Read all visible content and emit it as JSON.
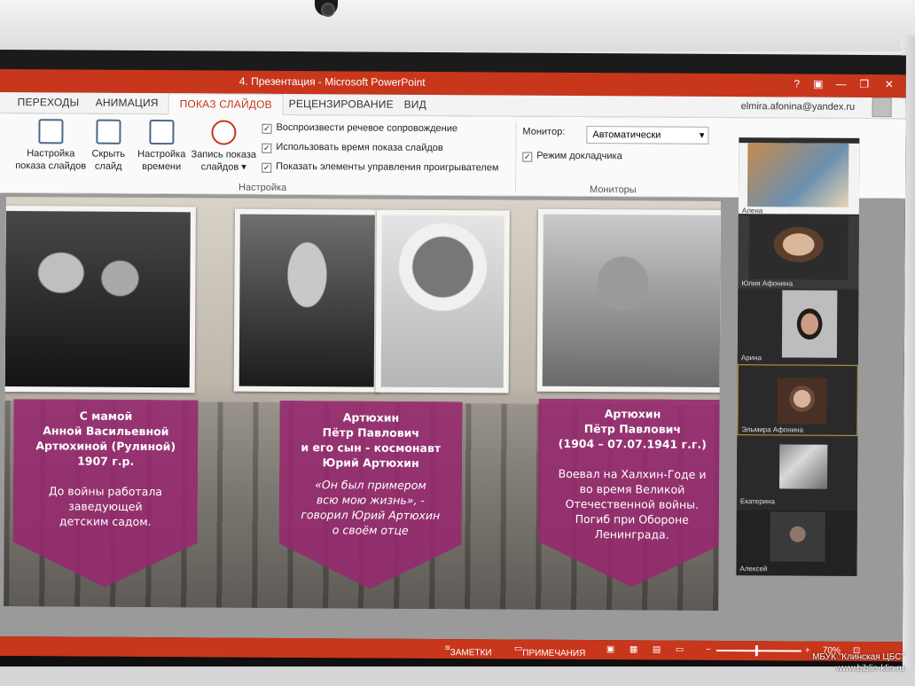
{
  "window": {
    "title": "4. Презентация -  Microsoft PowerPoint",
    "help": "?",
    "account": "elmira.afonina@yandex.ru"
  },
  "tabs": [
    "ПЕРЕХОДЫ",
    "АНИМАЦИЯ",
    "ПОКАЗ СЛАЙДОВ",
    "РЕЦЕНЗИРОВАНИЕ",
    "ВИД"
  ],
  "active_tab": "ПОКАЗ СЛАЙДОВ",
  "ribbon": {
    "buttons": [
      {
        "label1": "Настройка",
        "label2": "показа слайдов"
      },
      {
        "label1": "Скрыть",
        "label2": "слайд"
      },
      {
        "label1": "Настройка",
        "label2": "времени"
      },
      {
        "label1": "Запись показа",
        "label2": "слайдов ▾"
      }
    ],
    "checks": [
      "Воспроизвести речевое сопровождение",
      "Использовать время показа слайдов",
      "Показать элементы управления проигрывателем"
    ],
    "group_setup": "Настройка",
    "monitor_label": "Монитор:",
    "monitor_value": "Автоматически",
    "presenter_mode": "Режим докладчика",
    "group_monitors": "Мониторы"
  },
  "slide": {
    "banner1": {
      "lines": [
        "С мамой",
        "Анной Васильевной",
        "Артюхиной (Рулиной)",
        "1907 г.р."
      ],
      "para": [
        "До войны работала",
        "заведующей",
        "детским садом."
      ]
    },
    "banner2": {
      "lines": [
        "Артюхин",
        "Пётр Павлович",
        "и его сын  - космонавт",
        "Юрий Артюхин"
      ],
      "quote": [
        "«Он был примером",
        "всю мою жизнь», -",
        "говорил Юрий Артюхин",
        "о своём отце"
      ]
    },
    "banner3": {
      "lines": [
        "Артюхин",
        "Пётр Павлович",
        "(1904 – 07.07.1941 г.г.)"
      ],
      "para": [
        "Воевал на Халхин-Годе и",
        "во время Великой",
        "Отечественной войны.",
        "Погиб при Обороне",
        "Ленинграда."
      ]
    }
  },
  "participants": [
    "Алена",
    "Юлия Афонина",
    "Арина",
    "Эльмира Афонина",
    "Екатерина",
    "Алексей"
  ],
  "statusbar": {
    "notes": "ЗАМЕТКИ",
    "comments": "ПРИМЕЧАНИЯ",
    "zoom": "70%"
  },
  "watermark": {
    "line1": "МБУК \"Клинская ЦБС\"",
    "line2": "www.biblio-klin.ru"
  }
}
